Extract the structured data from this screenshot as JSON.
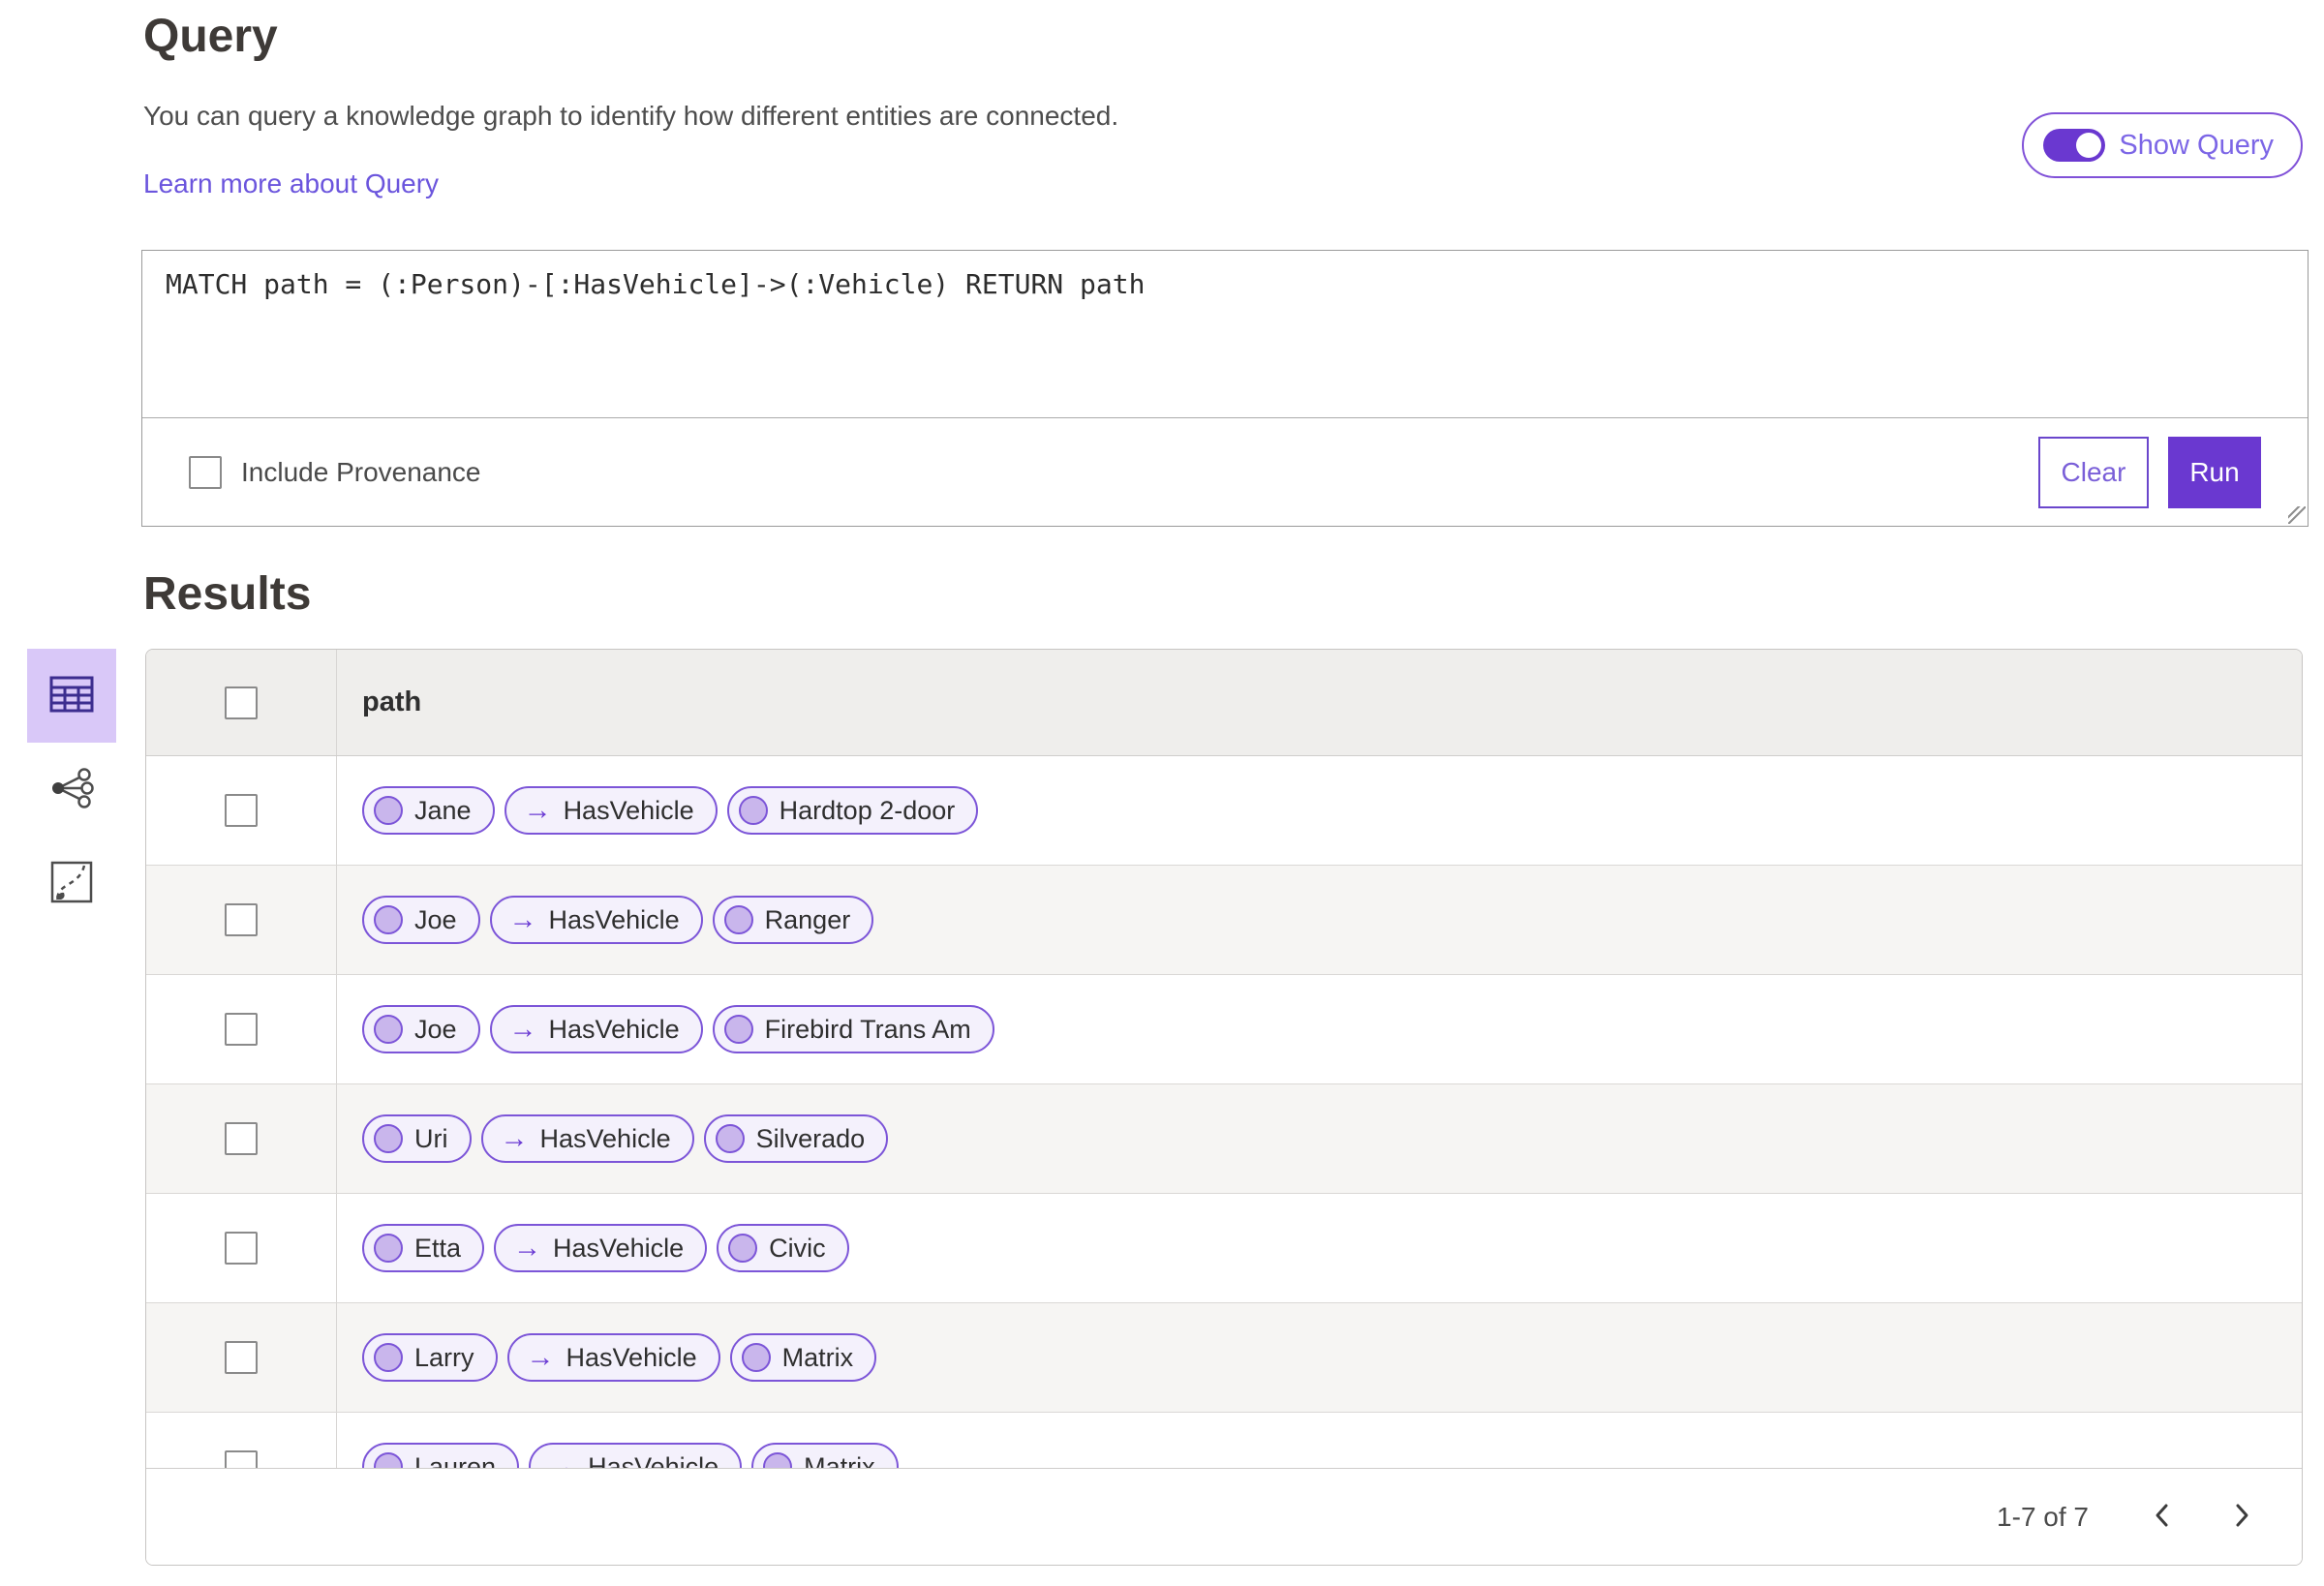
{
  "page": {
    "title": "Query",
    "description": "You can query a knowledge graph to identify how different entities are connected.",
    "learn_more": "Learn more about Query",
    "show_query_label": "Show Query",
    "query_text": "MATCH path = (:Person)-[:HasVehicle]->(:Vehicle) RETURN path",
    "include_provenance_label": "Include Provenance",
    "clear_label": "Clear",
    "run_label": "Run",
    "results_title": "Results"
  },
  "view_switcher": {
    "items": [
      {
        "name": "table-view",
        "icon": "table-icon",
        "active": true
      },
      {
        "name": "link-chart-view",
        "icon": "link-chart-icon",
        "active": false
      },
      {
        "name": "map-view",
        "icon": "map-icon",
        "active": false
      }
    ]
  },
  "results_table": {
    "column_header": "path",
    "rows": [
      {
        "source": "Jane",
        "relationship": "HasVehicle",
        "target": "Hardtop 2-door"
      },
      {
        "source": "Joe",
        "relationship": "HasVehicle",
        "target": "Ranger"
      },
      {
        "source": "Joe",
        "relationship": "HasVehicle",
        "target": "Firebird Trans Am"
      },
      {
        "source": "Uri",
        "relationship": "HasVehicle",
        "target": "Silverado"
      },
      {
        "source": "Etta",
        "relationship": "HasVehicle",
        "target": "Civic"
      },
      {
        "source": "Larry",
        "relationship": "HasVehicle",
        "target": "Matrix"
      },
      {
        "source": "Lauren",
        "relationship": "HasVehicle",
        "target": "Matrix"
      }
    ],
    "pagination": {
      "range_label": "1-7 of 7"
    }
  },
  "icons": {
    "arrow_right": "→"
  },
  "colors": {
    "accent_purple": "#6a38d0",
    "pill_border": "#7c55d8",
    "pill_background": "#f4f1fc",
    "node_fill": "#c9b6ec",
    "active_view_background": "#d9c8f8",
    "link_color": "#6b55dd",
    "header_row_background": "#efeeec",
    "alt_row_background": "#f6f5f3"
  }
}
